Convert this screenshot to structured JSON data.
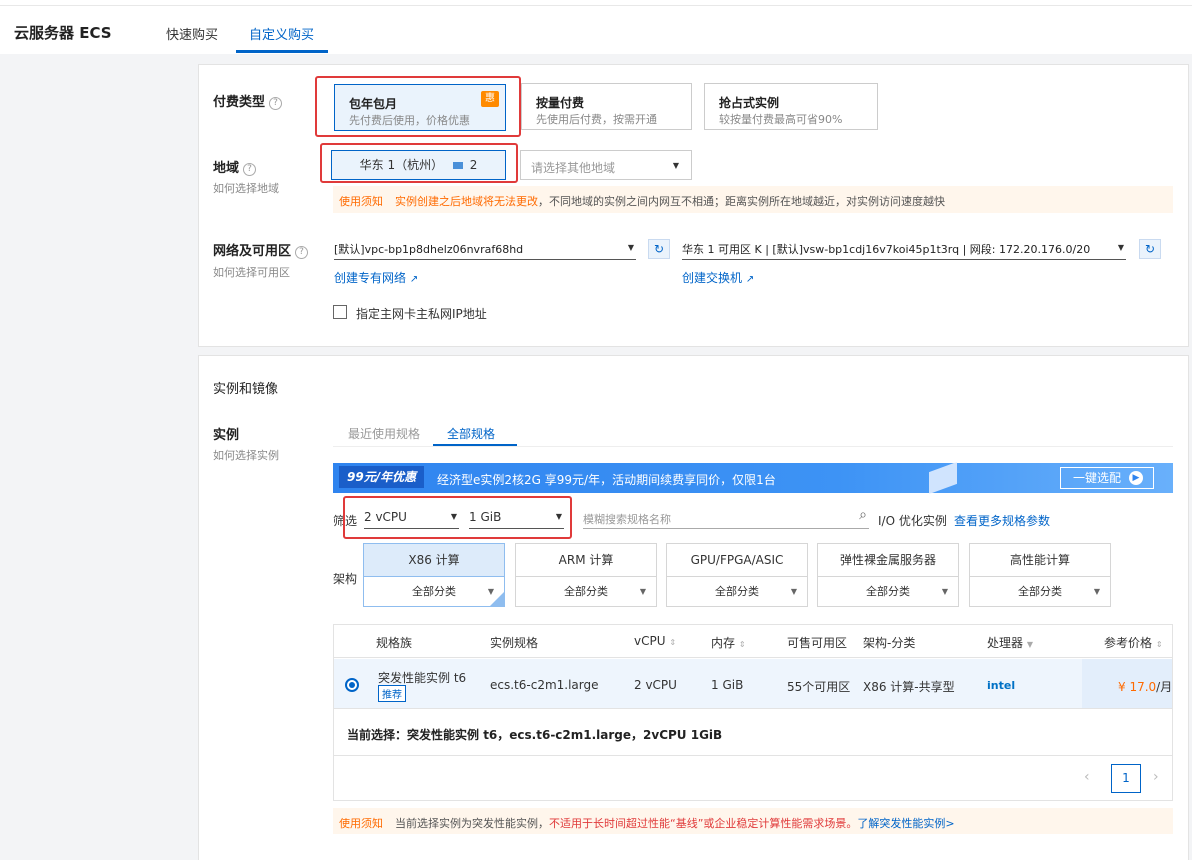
{
  "header": {
    "title": "云服务器 ECS",
    "tabs": [
      {
        "label": "快速购买"
      },
      {
        "label": "自定义购买"
      }
    ]
  },
  "billing": {
    "label": "付费类型",
    "options": [
      {
        "title": "包年包月",
        "sub": "先付费后使用，价格优惠",
        "badge": "惠"
      },
      {
        "title": "按量付费",
        "sub": "先使用后付费，按需开通"
      },
      {
        "title": "抢占式实例",
        "sub": "较按量付费最高可省90%"
      }
    ]
  },
  "region": {
    "label": "地域",
    "sub": "如何选择地域",
    "selected": "华东 1（杭州）",
    "selected_count": "2",
    "other_placeholder": "请选择其他地域",
    "notice_tag": "使用须知",
    "notice_warn": "实例创建之后地域将无法更改",
    "notice_rest": "，不同地域的实例之间内网互不相通；距离实例所在地域越近，对实例访问速度越快"
  },
  "network": {
    "label": "网络及可用区",
    "sub": "如何选择可用区",
    "vpc_value": "[默认]vpc-bp1p8dhelz06nvraf68hd",
    "vswitch_value": "华东 1 可用区 K | [默认]vsw-bp1cdj16v7koi45p1t3rq | 网段: 172.20.176.0/20",
    "create_vpc": "创建专有网络",
    "create_vswitch": "创建交换机",
    "private_ip_checkbox": "指定主网卡主私网IP地址"
  },
  "instance_section": {
    "title": "实例和镜像",
    "label": "实例",
    "sub": "如何选择实例",
    "tabs": [
      {
        "label": "最近使用规格"
      },
      {
        "label": "全部规格"
      }
    ],
    "banner": {
      "promo": "99元/年优惠",
      "text": "经济型e实例2核2G 享99元/年，活动期间续费享同价，仅限1台",
      "button": "一键选配"
    },
    "filter": {
      "label": "筛选",
      "cpu": "2 vCPU",
      "mem": "1 GiB",
      "search_placeholder": "模糊搜索规格名称",
      "io_opt": "I/O 优化实例",
      "more_link": "查看更多规格参数"
    },
    "arch": {
      "label": "架构",
      "items": [
        {
          "title": "X86 计算",
          "sub": "全部分类"
        },
        {
          "title": "ARM 计算",
          "sub": "全部分类"
        },
        {
          "title": "GPU/FPGA/ASIC",
          "sub": "全部分类"
        },
        {
          "title": "弹性裸金属服务器",
          "sub": "全部分类"
        },
        {
          "title": "高性能计算",
          "sub": "全部分类"
        }
      ]
    },
    "table": {
      "columns": [
        "规格族",
        "实例规格",
        "vCPU",
        "内存",
        "可售可用区",
        "架构-分类",
        "处理器",
        "参考价格"
      ],
      "row": {
        "family": "突发性能实例 t6",
        "tag": "推荐",
        "spec": "ecs.t6-c2m1.large",
        "vcpu": "2 vCPU",
        "mem": "1 GiB",
        "zones": "55个可用区",
        "arch": "X86 计算-共享型",
        "cpu_brand": "intel",
        "price": "¥ 17.0",
        "price_unit": "/月"
      },
      "current_label": "当前选择：",
      "current_value": "突发性能实例 t6，ecs.t6-c2m1.large，2vCPU 1GiB",
      "page": "1"
    },
    "notice": {
      "tag": "使用须知",
      "text1": "当前选择实例为突发性能实例，",
      "warn": "不适用于长时间超过性能“基线”或企业稳定计算性能需求场景。",
      "link": "了解突发性能实例>"
    }
  },
  "colors": {
    "accent": "#0064c8",
    "orange": "#ff6a00",
    "highlight": "#e03a3a"
  }
}
